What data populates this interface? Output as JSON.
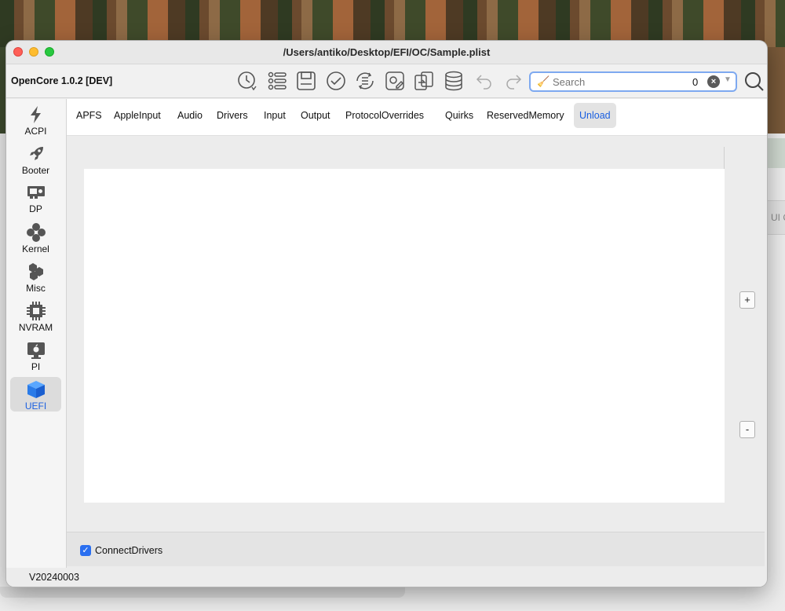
{
  "window": {
    "title": "/Users/antiko/Desktop/EFI/OC/Sample.plist"
  },
  "toolbar": {
    "app_name": "OpenCore 1.0.2 [DEV]",
    "icons": [
      "history-icon",
      "list-icon",
      "save-icon",
      "check-icon",
      "refresh-list-icon",
      "gear-edit-icon",
      "compare-icon",
      "database-icon",
      "undo-icon",
      "redo-icon"
    ],
    "search": {
      "placeholder": "Search",
      "count": "0"
    }
  },
  "sidebar": {
    "items": [
      {
        "label": "ACPI",
        "icon": "bolt-icon"
      },
      {
        "label": "Booter",
        "icon": "rocket-icon"
      },
      {
        "label": "DP",
        "icon": "gpu-icon"
      },
      {
        "label": "Kernel",
        "icon": "kernel-icon"
      },
      {
        "label": "Misc",
        "icon": "hexagons-icon"
      },
      {
        "label": "NVRAM",
        "icon": "chip-icon"
      },
      {
        "label": "PI",
        "icon": "apple-monitor-icon"
      },
      {
        "label": "UEFI",
        "icon": "cube-icon",
        "active": true
      }
    ]
  },
  "tabs": [
    "APFS",
    "AppleInput",
    "Audio",
    "Drivers",
    "Input",
    "Output",
    "ProtocolOverrides",
    "Quirks",
    "ReservedMemory",
    "Unload"
  ],
  "active_tab": "Unload",
  "buttons": {
    "add": "+",
    "remove": "-"
  },
  "options": {
    "connect_drivers_label": "ConnectDrivers",
    "connect_drivers_checked": true
  },
  "status": {
    "version": "V20240003"
  },
  "background": {
    "partial_tab_text": "UI C"
  },
  "colors": {
    "accent": "#1a5fe0",
    "checkbox": "#2a6ff0",
    "close": "#fe5f57",
    "minimize": "#febc2e",
    "maximize": "#28c840"
  }
}
